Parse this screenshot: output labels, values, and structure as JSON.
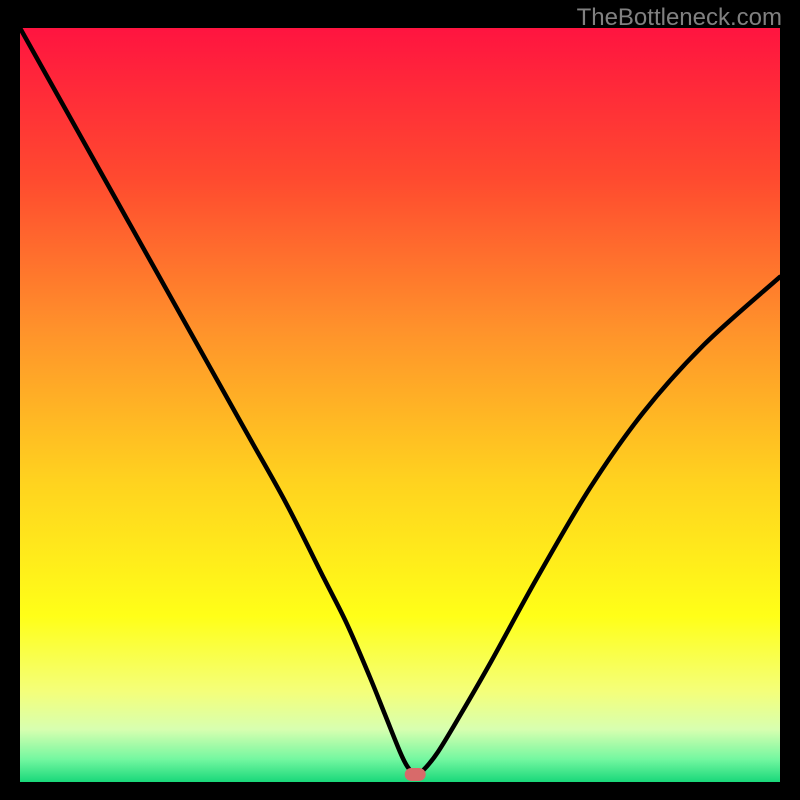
{
  "watermark": "TheBottleneck.com",
  "chart_data": {
    "type": "line",
    "title": "",
    "xlabel": "",
    "ylabel": "",
    "xlim": [
      0,
      100
    ],
    "ylim": [
      0,
      100
    ],
    "series": [
      {
        "name": "bottleneck-curve",
        "x": [
          0,
          5,
          10,
          15,
          20,
          25,
          30,
          35,
          40,
          43,
          46,
          48,
          50,
          51,
          52,
          53,
          55,
          58,
          62,
          68,
          75,
          82,
          90,
          100
        ],
        "y": [
          100,
          91,
          82,
          73,
          64,
          55,
          46,
          37,
          27,
          21,
          14,
          9,
          4,
          2,
          1,
          1.5,
          4,
          9,
          16,
          27,
          39,
          49,
          58,
          67
        ]
      }
    ],
    "marker": {
      "x": 52,
      "y": 1
    },
    "background_gradient": {
      "stops": [
        {
          "offset": 0.0,
          "color": "#ff1440"
        },
        {
          "offset": 0.2,
          "color": "#ff4a2f"
        },
        {
          "offset": 0.4,
          "color": "#ff922b"
        },
        {
          "offset": 0.6,
          "color": "#ffd21f"
        },
        {
          "offset": 0.78,
          "color": "#ffff18"
        },
        {
          "offset": 0.88,
          "color": "#f4ff7a"
        },
        {
          "offset": 0.93,
          "color": "#d8ffb0"
        },
        {
          "offset": 0.97,
          "color": "#73f7a0"
        },
        {
          "offset": 1.0,
          "color": "#19d87a"
        }
      ]
    }
  }
}
